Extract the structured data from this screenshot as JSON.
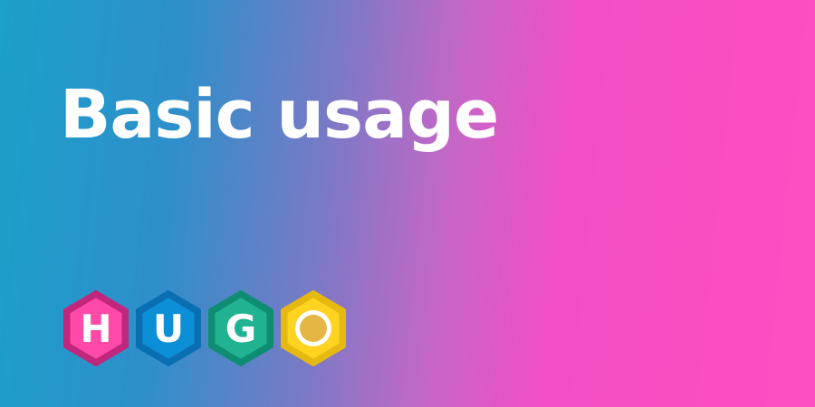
{
  "title": "Basic usage",
  "logo": {
    "name": "HUGO",
    "letters": [
      {
        "char": "H",
        "outer": "#c0267c",
        "inner": "#ff4aa8",
        "text": "#ffffff"
      },
      {
        "char": "U",
        "outer": "#0a6fb2",
        "inner": "#0d8fd8",
        "text": "#ffffff"
      },
      {
        "char": "G",
        "outer": "#0e8d73",
        "inner": "#21b391",
        "text": "#ffffff"
      },
      {
        "char": "O",
        "outer": "#e5b90f",
        "inner": "#ffd31f",
        "text": "#e6b645"
      }
    ]
  }
}
